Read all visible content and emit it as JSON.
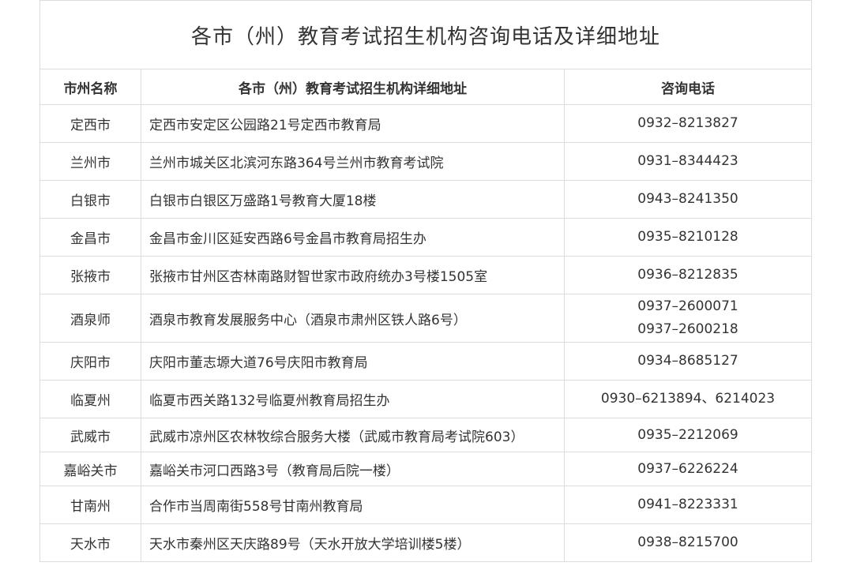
{
  "title": "各市（州）教育考试招生机构咨询电话及详细地址",
  "headers": {
    "city": "市州名称",
    "address": "各市（州）教育考试招生机构详细地址",
    "phone": "咨询电话"
  },
  "rows": [
    {
      "city": "定西市",
      "address": "定西市安定区公园路21号定西市教育局",
      "phones": [
        "0932–8213827"
      ]
    },
    {
      "city": "兰州市",
      "address": "兰州市城关区北滨河东路364号兰州市教育考试院",
      "phones": [
        "0931–8344423"
      ]
    },
    {
      "city": "白银市",
      "address": "白银市白银区万盛路1号教育大厦18楼",
      "phones": [
        "0943–8241350"
      ]
    },
    {
      "city": "金昌市",
      "address": "金昌市金川区延安西路6号金昌市教育局招生办",
      "phones": [
        "0935–8210128"
      ]
    },
    {
      "city": "张掖市",
      "address": "张掖市甘州区杏林南路财智世家市政府统办3号楼1505室",
      "phones": [
        "0936–8212835"
      ]
    },
    {
      "city": "酒泉师",
      "address": "酒泉市教育发展服务中心（酒泉市肃州区铁人路6号）",
      "phones": [
        "0937–2600071",
        "0937–2600218"
      ]
    },
    {
      "city": "庆阳市",
      "address": "庆阳市董志塬大道76号庆阳市教育局",
      "phones": [
        "0934–8685127"
      ]
    },
    {
      "city": "临夏州",
      "address": "临夏市西关路132号临夏州教育局招生办",
      "phones": [
        "0930–6213894、6214023"
      ]
    },
    {
      "city": "武威市",
      "address": "武威市凉州区农林牧综合服务大楼（武威市教育局考试院603）",
      "phones": [
        "0935–2212069"
      ]
    },
    {
      "city": "嘉峪关市",
      "address": "嘉峪关市河口西路3号（教育局后院一楼）",
      "phones": [
        "0937–6226224"
      ]
    },
    {
      "city": "甘南州",
      "address": "合作市当周南街558号甘南州教育局",
      "phones": [
        "0941–8223331"
      ]
    },
    {
      "city": "天水市",
      "address": "天水市秦州区天庆路89号（天水开放大学培训楼5楼）",
      "phones": [
        "0938–8215700"
      ]
    }
  ]
}
